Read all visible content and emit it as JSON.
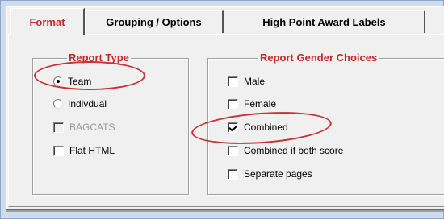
{
  "tabs": [
    {
      "label": "Format",
      "active": true
    },
    {
      "label": "Grouping / Options",
      "active": false
    },
    {
      "label": "High Point Award Labels",
      "active": false
    }
  ],
  "report_type": {
    "title": "Report Type",
    "options": [
      {
        "label": "Team",
        "kind": "radio",
        "selected": true,
        "enabled": true
      },
      {
        "label": "Indivdual",
        "kind": "radio",
        "selected": false,
        "enabled": true
      },
      {
        "label": "BAGCATS",
        "kind": "checkbox",
        "checked": false,
        "enabled": false
      },
      {
        "label": "Flat HTML",
        "kind": "checkbox",
        "checked": false,
        "enabled": true
      }
    ]
  },
  "gender_choices": {
    "title": "Report Gender Choices",
    "options": [
      {
        "label": "Male",
        "checked": false
      },
      {
        "label": "Female",
        "checked": false
      },
      {
        "label": "Combined",
        "checked": true
      },
      {
        "label": "Combined if both score",
        "checked": false
      },
      {
        "label": "Separate pages",
        "checked": false
      }
    ]
  },
  "colors": {
    "accent_text": "#c82828",
    "annotation": "#c83232",
    "window_frame": "#cfdcee"
  }
}
